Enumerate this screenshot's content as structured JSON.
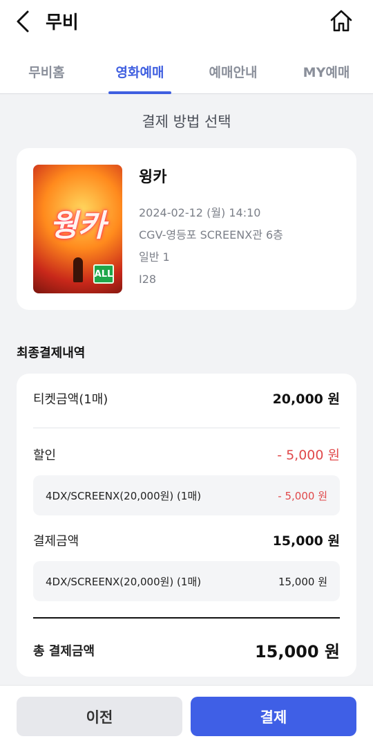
{
  "header": {
    "title": "무비",
    "back_icon": "chevron-left-icon",
    "home_icon": "home-icon"
  },
  "tabs": [
    {
      "label": "무비홈",
      "active": false
    },
    {
      "label": "영화예매",
      "active": true
    },
    {
      "label": "예매안내",
      "active": false
    },
    {
      "label": "MY예매",
      "active": false
    }
  ],
  "section_title": "결제 방법 선택",
  "movie": {
    "title": "윙카",
    "datetime": "2024-02-12 (월) 14:10",
    "theater": "CGV-영등포 SCREENX관 6층",
    "audience": "일반 1",
    "seat": "I28",
    "poster_text": "웡카",
    "poster_rating": "ALL"
  },
  "summary_label": "최종결제내역",
  "payment": {
    "ticket_label": "티켓금액(1매)",
    "ticket_value": "20,000 원",
    "discount_label": "할인",
    "discount_value": "- 5,000 원",
    "discount_item_label": "4DX/SCREENX(20,000원) (1매)",
    "discount_item_value": "- 5,000 원",
    "pay_label": "결제금액",
    "pay_value": "15,000 원",
    "pay_item_label": "4DX/SCREENX(20,000원) (1매)",
    "pay_item_value": "15,000 원",
    "total_label": "총 결제금액",
    "total_value": "15,000 원"
  },
  "buttons": {
    "prev": "이전",
    "pay": "결제"
  },
  "colors": {
    "accent": "#3f5fe6",
    "discount": "#e0484a"
  }
}
